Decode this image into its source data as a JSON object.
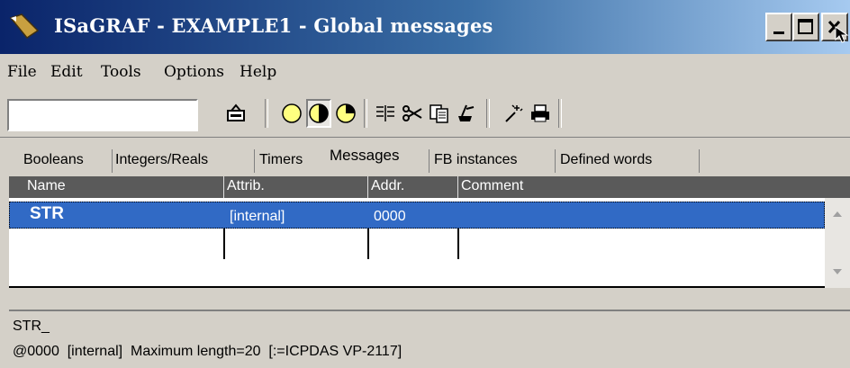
{
  "window": {
    "title": "ISaGRAF - EXAMPLE1 - Global messages"
  },
  "menu": [
    "File",
    "Edit",
    "Tools",
    "Options",
    "Help"
  ],
  "toolbar": {
    "search_value": ""
  },
  "tabs": [
    "Booleans",
    "Integers/Reals",
    "Timers",
    "Messages",
    "FB instances",
    "Defined words"
  ],
  "active_tab": "Messages",
  "columns": [
    "Name",
    "Attrib.",
    "Addr.",
    "Comment"
  ],
  "rows": [
    {
      "name": "STR",
      "attrib": "[internal]",
      "addr": "0000",
      "comment": ""
    }
  ],
  "status": {
    "line1": "STR_",
    "line2": "@0000  [internal]  Maximum length=20  [:=ICPDAS VP-2117]"
  },
  "colors": {
    "title_gradient_start": "#0a246a",
    "selection": "#316ac5",
    "header_bg": "#5a5a5a"
  },
  "icons": [
    "isagraf-logo-icon",
    "minimize-icon",
    "maximize-icon",
    "close-icon",
    "open-icon",
    "circle-empty-icon",
    "circle-half-icon",
    "circle-quarter-icon",
    "insert-icon",
    "cut-icon",
    "copy-icon",
    "paste-icon",
    "wand-icon",
    "print-icon"
  ]
}
